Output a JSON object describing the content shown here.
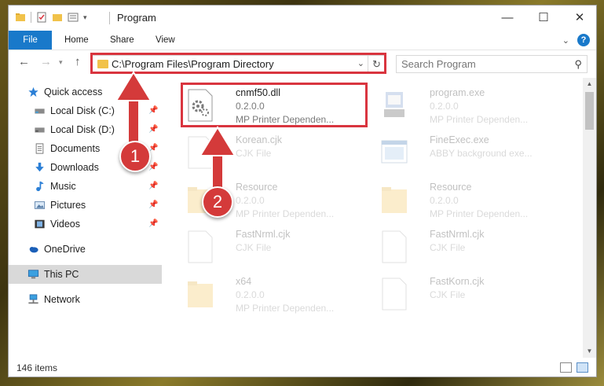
{
  "window": {
    "title": "Program",
    "minimize": "—",
    "maximize": "☐",
    "close": "✕"
  },
  "ribbon": {
    "tabs": [
      "File",
      "Home",
      "Share",
      "View"
    ]
  },
  "nav": {
    "address": "C:\\Program Files\\Program Directory",
    "search_placeholder": "Search Program"
  },
  "sidebar": {
    "items": [
      {
        "label": "Quick access",
        "icon": "star-icon"
      },
      {
        "label": "Local Disk (C:)",
        "icon": "drive-icon"
      },
      {
        "label": "Local Disk (D:)",
        "icon": "drive-icon"
      },
      {
        "label": "Documents",
        "icon": "documents-icon"
      },
      {
        "label": "Downloads",
        "icon": "download-icon"
      },
      {
        "label": "Music",
        "icon": "music-icon"
      },
      {
        "label": "Pictures",
        "icon": "pictures-icon"
      },
      {
        "label": "Videos",
        "icon": "videos-icon"
      },
      {
        "label": "OneDrive",
        "icon": "cloud-icon"
      },
      {
        "label": "This PC",
        "icon": "pc-icon"
      },
      {
        "label": "Network",
        "icon": "network-icon"
      }
    ]
  },
  "files": [
    {
      "name": "cnmf50.dll",
      "line1": "0.2.0.0",
      "line2": "MP Printer Dependen...",
      "icon": "dll-gear-icon"
    },
    {
      "name": "program.exe",
      "line1": "0.2.0.0",
      "line2": "MP Printer Dependen...",
      "icon": "exe-icon"
    },
    {
      "name": "Korean.cjk",
      "line1": "CJK File",
      "line2": "",
      "icon": "blank-file-icon"
    },
    {
      "name": "FineExec.exe",
      "line1": "ABBY background exe...",
      "line2": "",
      "icon": "exe-window-icon"
    },
    {
      "name": "Resource",
      "line1": "0.2.0.0",
      "line2": "MP Printer Dependen...",
      "icon": "folder-icon"
    },
    {
      "name": "Resource",
      "line1": "0.2.0.0",
      "line2": "MP Printer Dependen...",
      "icon": "folder-icon"
    },
    {
      "name": "FastNrml.cjk",
      "line1": "CJK File",
      "line2": "",
      "icon": "blank-file-icon"
    },
    {
      "name": "FastNrml.cjk",
      "line1": "CJK File",
      "line2": "",
      "icon": "blank-file-icon"
    },
    {
      "name": "x64",
      "line1": "0.2.0.0",
      "line2": "MP Printer Dependen...",
      "icon": "folder-icon"
    },
    {
      "name": "FastKorn.cjk",
      "line1": "CJK File",
      "line2": "",
      "icon": "blank-file-icon"
    }
  ],
  "status": {
    "items_count": "146 items"
  },
  "annotations": {
    "badge1": "1",
    "badge2": "2",
    "highlight_color": "#d9353f"
  }
}
